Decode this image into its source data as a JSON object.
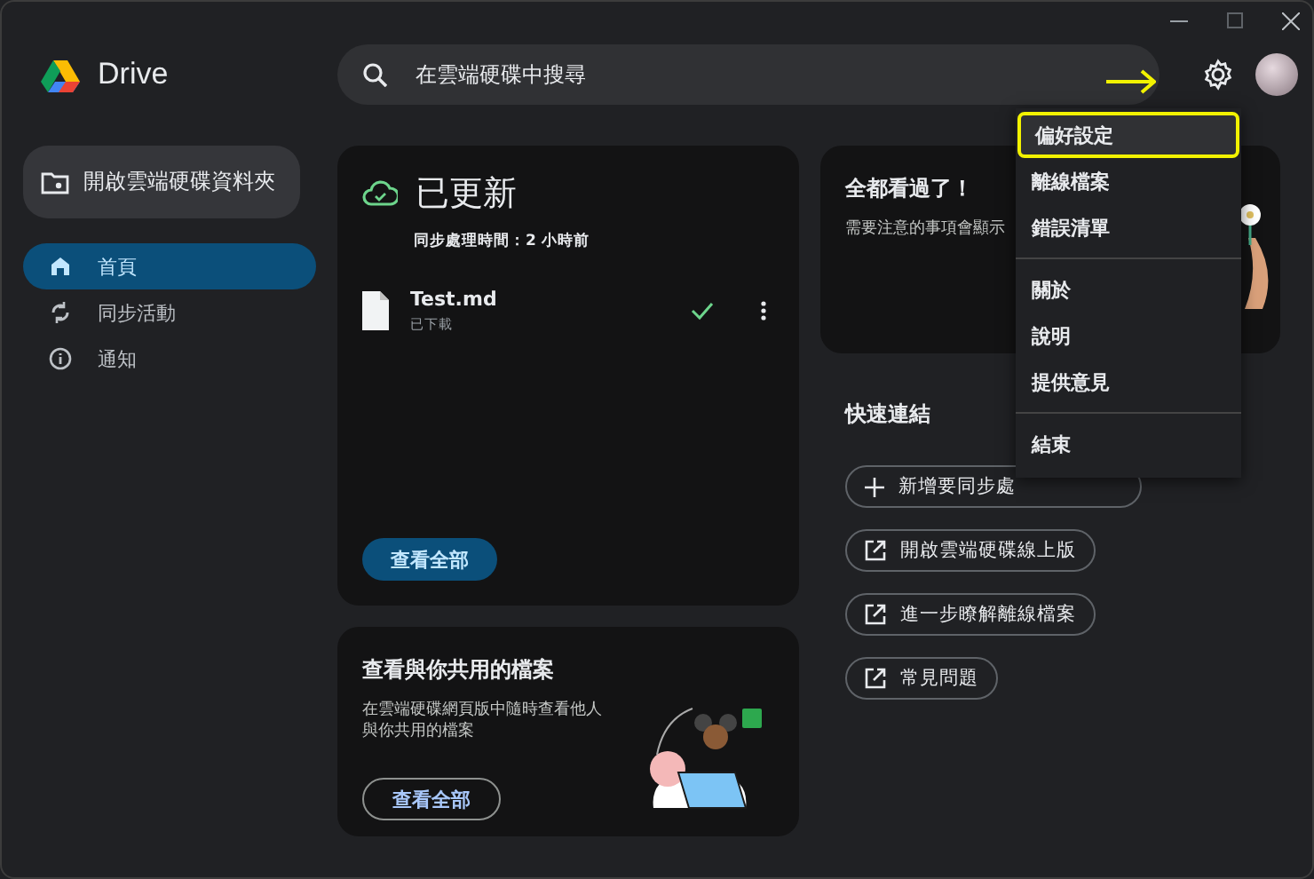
{
  "app": {
    "name": "Drive"
  },
  "search": {
    "placeholder": "在雲端硬碟中搜尋"
  },
  "sidebar": {
    "open_folder_button": "開啟雲端硬碟資料夾",
    "items": [
      {
        "label": "首頁",
        "selected": true
      },
      {
        "label": "同步活動",
        "selected": false
      },
      {
        "label": "通知",
        "selected": false
      }
    ]
  },
  "status_card": {
    "title": "已更新",
    "subtitle": "同步處理時間：2 小時前",
    "files": [
      {
        "name": "Test.md",
        "status": "已下載",
        "synced": true
      }
    ],
    "button": "查看全部"
  },
  "shared_card": {
    "title": "查看與你共用的檔案",
    "text": "在雲端硬碟網頁版中隨時查看他人與你共用的檔案",
    "button": "查看全部"
  },
  "notice_card": {
    "title": "全都看過了！",
    "text": "需要注意的事項會顯示"
  },
  "quick_links": {
    "title": "快速連結",
    "items": [
      {
        "kind": "add",
        "label": "新增要同步處"
      },
      {
        "kind": "external",
        "label": "開啟雲端硬碟線上版"
      },
      {
        "kind": "external",
        "label": "進一步瞭解離線檔案"
      },
      {
        "kind": "external",
        "label": "常見問題"
      }
    ]
  },
  "settings_menu": {
    "groups": [
      [
        {
          "label": "偏好設定",
          "highlighted": true
        },
        {
          "label": "離線檔案",
          "highlighted": false
        },
        {
          "label": "錯誤清單",
          "highlighted": false
        }
      ],
      [
        {
          "label": "關於",
          "highlighted": false
        },
        {
          "label": "說明",
          "highlighted": false
        },
        {
          "label": "提供意見",
          "highlighted": false
        }
      ],
      [
        {
          "label": "結束",
          "highlighted": false
        }
      ]
    ]
  }
}
